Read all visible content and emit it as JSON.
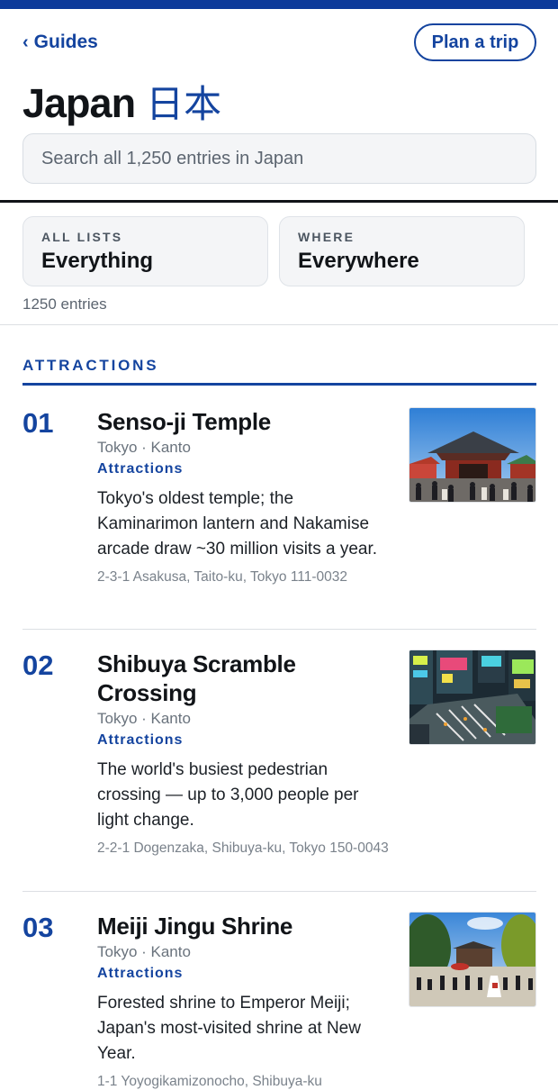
{
  "header": {
    "back_label": "Guides",
    "plan_button": "Plan a trip",
    "title": "Japan",
    "title_native": "日本",
    "search_placeholder": "Search all 1,250 entries in Japan"
  },
  "filters": {
    "lists": {
      "label": "ALL LISTS",
      "value": "Everything"
    },
    "where": {
      "label": "WHERE",
      "value": "Everywhere"
    },
    "count": "1250 entries"
  },
  "section": {
    "title": "ATTRACTIONS"
  },
  "entries": [
    {
      "number": "01",
      "name": "Senso-ji Temple",
      "location": "Tokyo · Kanto",
      "category": "Attractions",
      "description": "Tokyo's oldest temple; the Kaminarimon lantern and Nakamise arcade draw ~30 million visits a year.",
      "address": "2-3-1 Asakusa, Taito-ku, Tokyo 111-0032",
      "image": "temple-photo"
    },
    {
      "number": "02",
      "name": "Shibuya Scramble Crossing",
      "location": "Tokyo · Kanto",
      "category": "Attractions",
      "description": "The world's busiest pedestrian crossing — up to 3,000 people per light change.",
      "address": "2-2-1 Dogenzaka, Shibuya-ku, Tokyo 150-0043",
      "image": "crossing-photo"
    },
    {
      "number": "03",
      "name": "Meiji Jingu Shrine",
      "location": "Tokyo · Kanto",
      "category": "Attractions",
      "description": "Forested shrine to Emperor Meiji; Japan's most-visited shrine at New Year.",
      "address": "1-1 Yoyogikamizonocho, Shibuya-ku",
      "image": "shrine-photo"
    }
  ],
  "colors": {
    "accent": "#14449f",
    "topbar": "#0c3a9a"
  }
}
